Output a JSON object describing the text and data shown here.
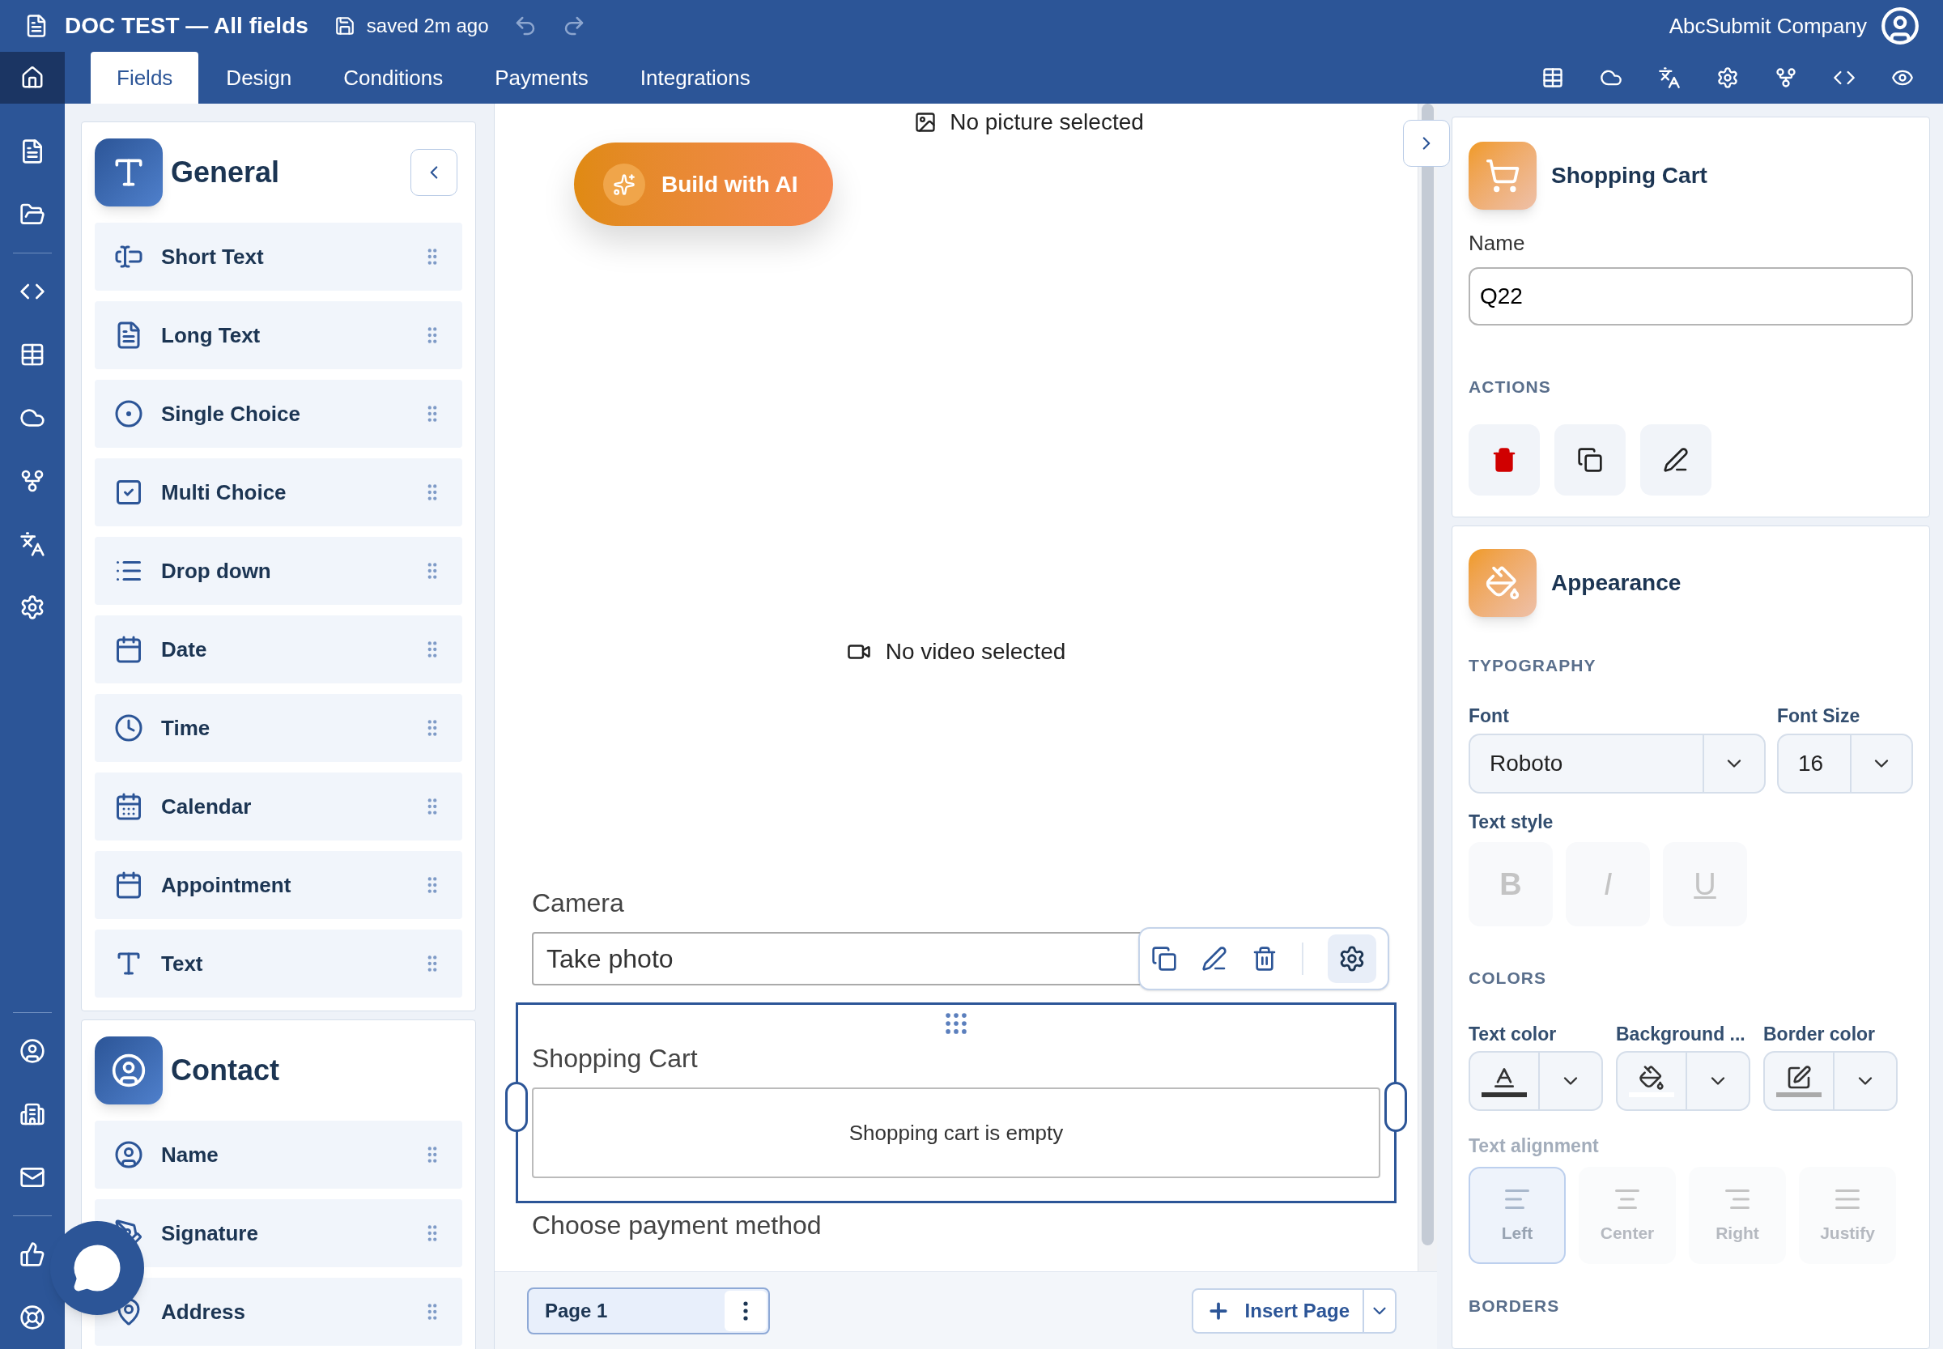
{
  "header": {
    "title": "DOC TEST — All fields",
    "save_status": "saved 2m ago",
    "company": "AbcSubmit Company"
  },
  "tabs": [
    {
      "label": "Fields",
      "selected": true
    },
    {
      "label": "Design",
      "selected": false
    },
    {
      "label": "Conditions",
      "selected": false
    },
    {
      "label": "Payments",
      "selected": false
    },
    {
      "label": "Integrations",
      "selected": false
    }
  ],
  "sidebar_groups": [
    {
      "title": "General",
      "items": [
        {
          "label": "Short Text"
        },
        {
          "label": "Long Text"
        },
        {
          "label": "Single Choice"
        },
        {
          "label": "Multi Choice"
        },
        {
          "label": "Drop down"
        },
        {
          "label": "Date"
        },
        {
          "label": "Time"
        },
        {
          "label": "Calendar"
        },
        {
          "label": "Appointment"
        },
        {
          "label": "Text"
        }
      ]
    },
    {
      "title": "Contact",
      "items": [
        {
          "label": "Name"
        },
        {
          "label": "Signature"
        },
        {
          "label": "Address"
        }
      ]
    }
  ],
  "canvas": {
    "picture_status": "No picture selected",
    "ai_button": "Build with AI",
    "video_status": "No video selected",
    "fields": [
      {
        "kind": "camera",
        "label": "Camera",
        "value": "Take photo",
        "selected": false
      },
      {
        "kind": "cart",
        "label": "Shopping Cart",
        "empty_text": "Shopping cart is empty",
        "selected": true
      },
      {
        "kind": "heading",
        "label": "Choose payment method",
        "selected": false
      }
    ]
  },
  "pages": [
    {
      "label": "Page 1",
      "selected": true
    }
  ],
  "insert_page": "Insert Page",
  "properties": {
    "title": "Shopping Cart",
    "name_label": "Name",
    "name_value": "Q22",
    "actions_label": "ACTIONS",
    "appearance_title": "Appearance",
    "typography_label": "TYPOGRAPHY",
    "font_label": "Font",
    "font_value": "Roboto",
    "font_size_label": "Font Size",
    "font_size_value": "16",
    "text_style_label": "Text style",
    "text_styles": [
      {
        "label": "B",
        "disabled": true
      },
      {
        "label": "I",
        "disabled": true
      },
      {
        "label": "U",
        "disabled": true
      }
    ],
    "colors_label": "COLORS",
    "colors": [
      {
        "label": "Text color",
        "color": "#333333"
      },
      {
        "label": "Background ...",
        "color": "#ffffff"
      },
      {
        "label": "Border color",
        "color": "#aaaaaa"
      }
    ],
    "alignment_label": "Text alignment",
    "alignment_disabled": true,
    "alignments": [
      {
        "label": "Left",
        "selected": true
      },
      {
        "label": "Center",
        "selected": false
      },
      {
        "label": "Right",
        "selected": false
      },
      {
        "label": "Justify",
        "selected": false
      }
    ],
    "borders_label": "BORDERS"
  }
}
